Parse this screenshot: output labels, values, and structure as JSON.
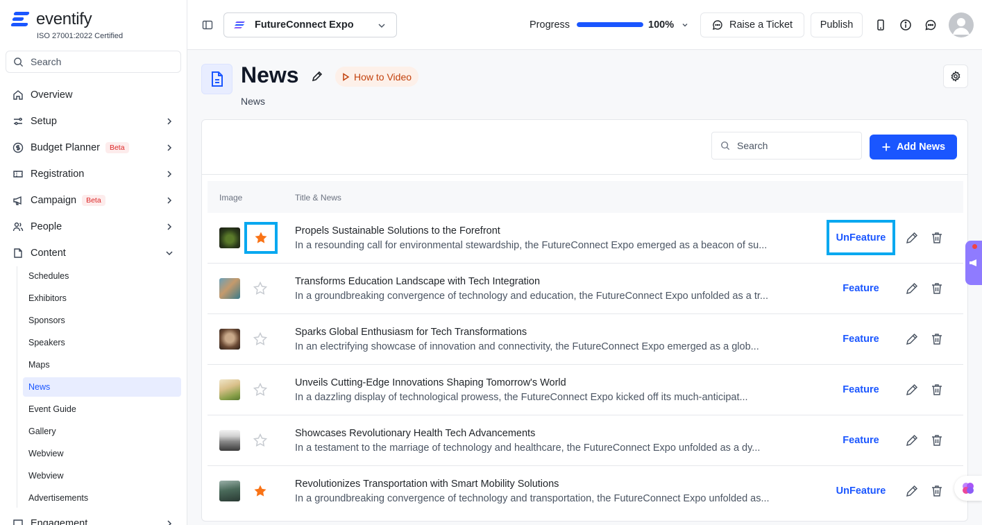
{
  "brand": {
    "name": "eventify",
    "certification": "ISO 27001:2022 Certified"
  },
  "sidebar": {
    "search_placeholder": "Search",
    "items": [
      {
        "label": "Overview",
        "icon": "home-icon"
      },
      {
        "label": "Setup",
        "icon": "sliders-icon"
      },
      {
        "label": "Budget Planner",
        "icon": "dollar-icon",
        "badge": "Beta"
      },
      {
        "label": "Registration",
        "icon": "ticket-icon"
      },
      {
        "label": "Campaign",
        "icon": "megaphone-icon",
        "badge": "Beta"
      },
      {
        "label": "People",
        "icon": "people-icon"
      },
      {
        "label": "Content",
        "icon": "content-icon"
      }
    ],
    "content_sub": [
      "Schedules",
      "Exhibitors",
      "Sponsors",
      "Speakers",
      "Maps",
      "News",
      "Event Guide",
      "Gallery",
      "Webview",
      "Webview",
      "Advertisements"
    ],
    "active_sub": "News",
    "last_item": "Engagement"
  },
  "topbar": {
    "event_name": "FutureConnect Expo",
    "progress_label": "Progress",
    "progress_value": "100%",
    "progress_fraction": 1.0,
    "ticket_label": "Raise a Ticket",
    "publish_label": "Publish"
  },
  "page": {
    "title": "News",
    "subtitle": "News",
    "howto_label": "How to Video"
  },
  "card": {
    "search_placeholder": "Search",
    "add_label": "Add News",
    "columns": [
      "Image",
      "Title & News"
    ]
  },
  "rows": [
    {
      "title": "Propels Sustainable Solutions to the Forefront",
      "desc": "In a resounding call for environmental stewardship, the FutureConnect Expo emerged as a beacon of su...",
      "featured": true,
      "action": "UnFeature"
    },
    {
      "title": "Transforms Education Landscape with Tech Integration",
      "desc": "In a groundbreaking convergence of technology and education, the FutureConnect Expo unfolded as a tr...",
      "featured": false,
      "action": "Feature"
    },
    {
      "title": "Sparks Global Enthusiasm for Tech Transformations",
      "desc": "In an electrifying showcase of innovation and connectivity, the FutureConnect Expo emerged as a glob...",
      "featured": false,
      "action": "Feature"
    },
    {
      "title": "Unveils Cutting-Edge Innovations Shaping Tomorrow's World",
      "desc": "In a dazzling display of technological prowess, the FutureConnect Expo kicked off its much-anticipat...",
      "featured": false,
      "action": "Feature"
    },
    {
      "title": "Showcases Revolutionary Health Tech Advancements",
      "desc": "In a testament to the marriage of technology and healthcare, the FutureConnect Expo unfolded as a dy...",
      "featured": false,
      "action": "Feature"
    },
    {
      "title": "Revolutionizes Transportation with Smart Mobility Solutions",
      "desc": "In a groundbreaking convergence of technology and transportation, the FutureConnect Expo unfolded as...",
      "featured": true,
      "action": "UnFeature"
    }
  ],
  "colors": {
    "accent": "#1a56ff",
    "star_active": "#f97316",
    "star_inactive": "#c7cbd1",
    "highlight": "#08a8f0"
  }
}
